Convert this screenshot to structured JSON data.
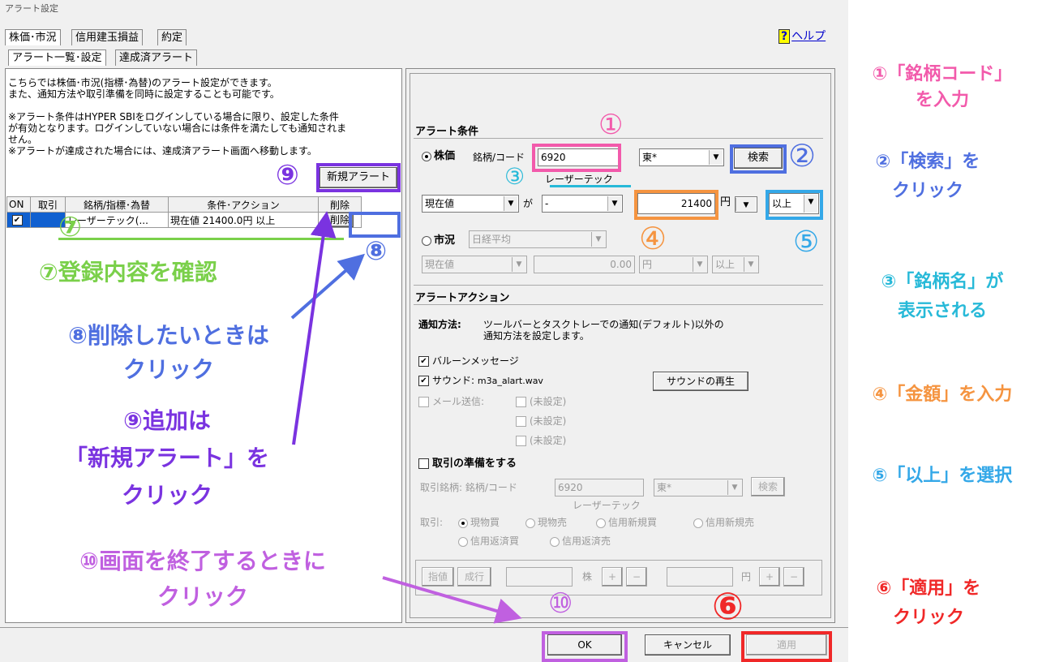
{
  "window": {
    "title": "アラート設定",
    "top_tabs": [
      "株価･市況",
      "信用建玉損益",
      "約定"
    ],
    "sub_tabs": [
      "アラート一覧･設定",
      "達成済アラート"
    ],
    "help_icon_label": "?",
    "help_label": "ヘルプ"
  },
  "left": {
    "desc1": "こちらでは株価･市況(指標･為替)のアラート設定ができます。\nまた、通知方法や取引準備を同時に設定することも可能です。",
    "desc2": "※アラート条件はHYPER SBIをログインしている場合に限り、設定した条件\nが有効となります。ログインしていない場合には条件を満たしても通知されま\nせん。\n※アラートが達成された場合には、達成済アラート画面へ移動します。",
    "new_alert_button": "新規アラート",
    "table_headers": [
      "ON",
      "取引",
      "銘柄/指標･為替",
      "条件･アクション",
      "削除"
    ],
    "row": {
      "on": "✔",
      "name": "レーザーテック(...",
      "condition": "現在値 21400.0円 以上",
      "delete_button": "削除"
    }
  },
  "alert_condition": {
    "header": "アラート条件",
    "stock_label": "株価",
    "code_label": "銘柄/コード",
    "code_value": "6920",
    "market_value": "東*",
    "search_button": "検索",
    "company_name": "レーザーテック",
    "price_type": "現在値",
    "ga_label": "が",
    "operator": "-",
    "amount": "21400",
    "unit": "円",
    "comparison": "以上",
    "market_label": "市況",
    "market_index": "日経平均",
    "market_price_type": "現在値",
    "market_amount": "0.00",
    "market_unit": "円",
    "market_comparison": "以上"
  },
  "alert_action": {
    "header": "アラートアクション",
    "notify_label": "通知方法:",
    "notify_desc": "ツールバーとタスクトレーでの通知(デフォルト)以外の\n通知方法を設定します。",
    "balloon": "バルーンメッセージ",
    "sound": "サウンド:",
    "sound_file": "m3a_alart.wav",
    "play_sound_button": "サウンドの再生",
    "mail": "メール送信:",
    "unset": "(未設定)"
  },
  "trade_prep": {
    "checkbox_label": "取引の準備をする",
    "stock_label": "取引銘柄:",
    "code_label": "銘柄/コード",
    "code_value": "6920",
    "market_value": "東*",
    "search_button": "検索",
    "company_name": "レーザーテック",
    "trade_label": "取引:",
    "options": [
      "現物買",
      "現物売",
      "信用新規買",
      "信用新規売",
      "信用返済買",
      "信用返済売"
    ],
    "limit_button": "指値",
    "market_button": "成行",
    "shares_unit": "株",
    "yen_unit": "円",
    "plus": "+",
    "minus": "−"
  },
  "footer": {
    "ok": "OK",
    "cancel": "キャンセル",
    "apply": "適用"
  },
  "annotations": {
    "n1": "①",
    "n2": "②",
    "n3": "③",
    "n4": "④",
    "n5": "⑤",
    "n6": "⑥",
    "n7": "⑦",
    "n8": "⑧",
    "n9": "⑨",
    "n10": "⑩",
    "a7": "⑦登録内容を確認",
    "a8": "⑧削除したいときは\nクリック",
    "a9": "⑨追加は\n「新規アラート」を\nクリック",
    "a10": "⑩画面を終了するときに\nクリック",
    "r1": "①「銘柄コード」\nを入力",
    "r2": "②「検索」を\nクリック",
    "r3": "③「銘柄名」が\n表示される",
    "r4": "④「金額」を入力",
    "r5": "⑤「以上」を選択",
    "r6": "⑥「適用」を\nクリック"
  },
  "colors": {
    "pink": "#f25aab",
    "blue": "#4f6fe0",
    "cyan": "#27b9d8",
    "orange": "#f59440",
    "lightblue": "#34a8e8",
    "red": "#f02828",
    "green": "#7ad04a",
    "violet": "#7a33e0",
    "purple": "#c060e0"
  }
}
